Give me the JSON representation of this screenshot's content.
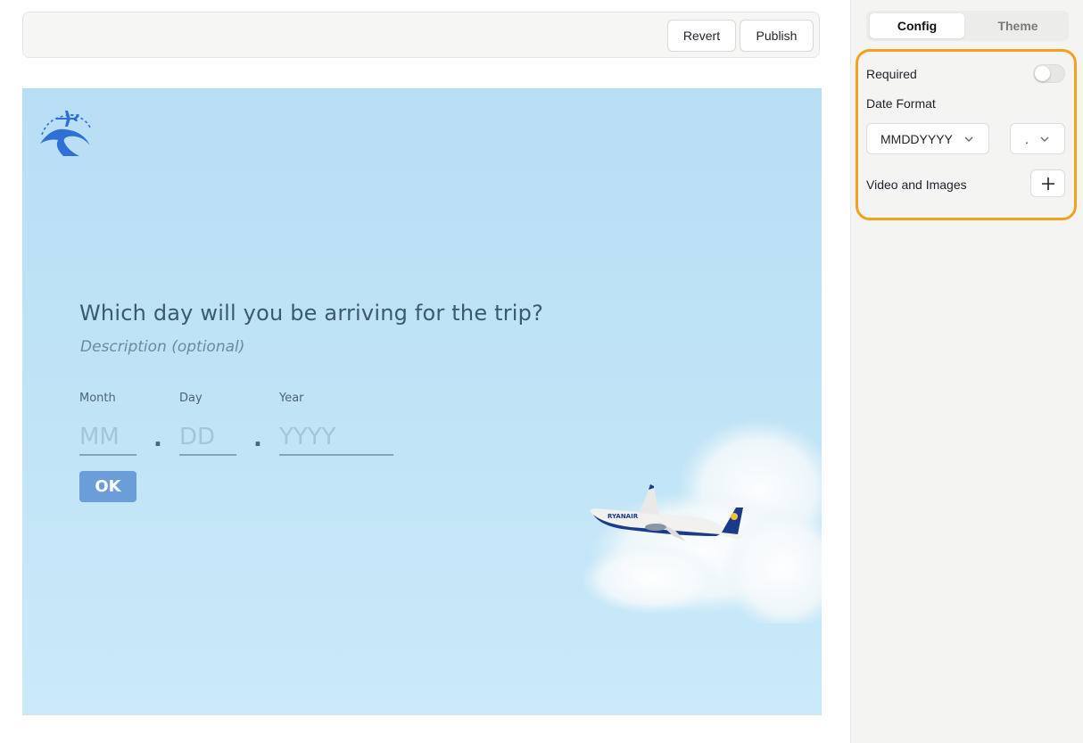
{
  "toolbar": {
    "revert_label": "Revert",
    "publish_label": "Publish"
  },
  "form": {
    "question": "Which day will you be arriving for the trip?",
    "description_placeholder": "Description (optional)",
    "fields": [
      {
        "label": "Month",
        "placeholder": "MM"
      },
      {
        "label": "Day",
        "placeholder": "DD"
      },
      {
        "label": "Year",
        "placeholder": "YYYY"
      }
    ],
    "separator": ".",
    "ok_label": "OK",
    "background_color": "#b8def4",
    "button_color": "#6b9ed8"
  },
  "panel": {
    "tabs": [
      {
        "label": "Config",
        "active": true
      },
      {
        "label": "Theme",
        "active": false
      }
    ],
    "required_label": "Required",
    "required_on": false,
    "date_format_label": "Date Format",
    "date_format_value": "MMDDYYYY",
    "separator_value": ".",
    "media_label": "Video and Images",
    "highlight_color": "#f5a020"
  }
}
